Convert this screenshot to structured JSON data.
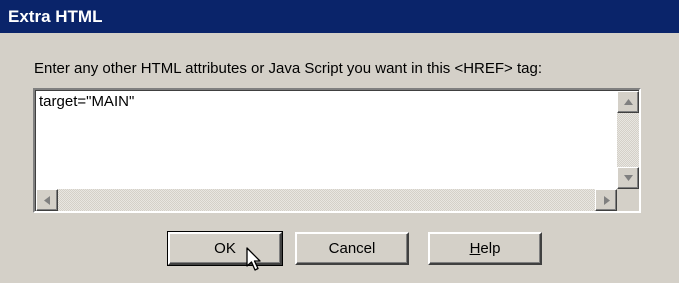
{
  "dialog": {
    "title": "Extra HTML",
    "prompt": "Enter any other HTML attributes or Java Script you want in this <HREF> tag:",
    "textarea_value": "target=\"MAIN\""
  },
  "buttons": {
    "ok": "OK",
    "cancel": "Cancel",
    "help_mnemonic": "H",
    "help_rest": "elp"
  },
  "icons": {
    "scroll_up": "triangle-up-icon",
    "scroll_down": "triangle-down-icon",
    "scroll_left": "triangle-left-icon",
    "scroll_right": "triangle-right-icon",
    "cursor": "mouse-pointer-icon"
  },
  "colors": {
    "titlebar": "#0a246a",
    "face": "#d4d0c8"
  }
}
